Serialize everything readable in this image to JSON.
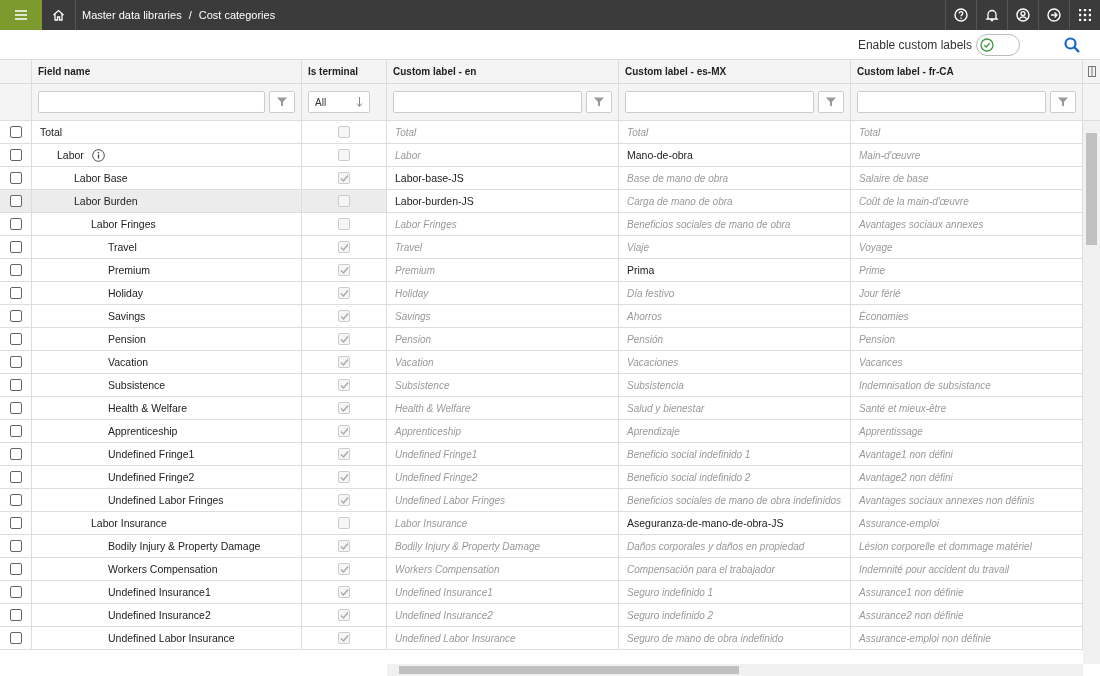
{
  "top_bar": {
    "breadcrumb": [
      {
        "label": "Master data libraries"
      },
      {
        "label": "Cost categories"
      }
    ],
    "separator": "/"
  },
  "toolbar": {
    "toggle_label": "Enable custom labels",
    "custom_labels_on": true
  },
  "table": {
    "columns": [
      {
        "label": "Field name",
        "kind": "text"
      },
      {
        "label": "Is terminal",
        "kind": "select",
        "value": "All"
      },
      {
        "label": "Custom label - en",
        "kind": "text"
      },
      {
        "label": "Custom label - es-MX",
        "kind": "text"
      },
      {
        "label": "Custom label - fr-CA",
        "kind": "text"
      }
    ],
    "rows": [
      {
        "name": "Total",
        "selected": false,
        "checked": false,
        "terminal": false,
        "labels": [
          {
            "text": "Total",
            "custom": false
          },
          {
            "text": "Total",
            "custom": false
          },
          {
            "text": "Total",
            "custom": false
          }
        ],
        "children": [
          {
            "name": "Labor",
            "info": true,
            "selected": false,
            "checked": false,
            "terminal": false,
            "labels": [
              {
                "text": "Labor",
                "custom": false
              },
              {
                "text": "Mano-de-obra",
                "custom": true
              },
              {
                "text": "Main-d'œuvre",
                "custom": false
              }
            ],
            "children": [
              {
                "name": "Labor Base",
                "selected": false,
                "checked": false,
                "terminal": true,
                "labels": [
                  {
                    "text": "Labor-base-JS",
                    "custom": true
                  },
                  {
                    "text": "Base de mano de obra",
                    "custom": false
                  },
                  {
                    "text": "Salaire de base",
                    "custom": false
                  }
                ]
              },
              {
                "name": "Labor Burden",
                "selected": true,
                "checked": false,
                "terminal": false,
                "labels": [
                  {
                    "text": "Labor-burden-JS",
                    "custom": true
                  },
                  {
                    "text": "Carga de mano de obra",
                    "custom": false
                  },
                  {
                    "text": "Coût de la main-d'œuvre",
                    "custom": false
                  }
                ],
                "children": [
                  {
                    "name": "Labor Fringes",
                    "selected": false,
                    "checked": false,
                    "terminal": false,
                    "labels": [
                      {
                        "text": "Labor Fringes",
                        "custom": false
                      },
                      {
                        "text": "Beneficios sociales de mano de obra",
                        "custom": false
                      },
                      {
                        "text": "Avantages sociaux annexes",
                        "custom": false
                      }
                    ],
                    "children": [
                      {
                        "name": "Travel",
                        "selected": false,
                        "checked": false,
                        "terminal": true,
                        "labels": [
                          {
                            "text": "Travel",
                            "custom": false
                          },
                          {
                            "text": "Viaje",
                            "custom": false
                          },
                          {
                            "text": "Voyage",
                            "custom": false
                          }
                        ]
                      },
                      {
                        "name": "Premium",
                        "selected": false,
                        "checked": false,
                        "terminal": true,
                        "labels": [
                          {
                            "text": "Premium",
                            "custom": false
                          },
                          {
                            "text": "Prima",
                            "custom": true
                          },
                          {
                            "text": "Prime",
                            "custom": false
                          }
                        ]
                      },
                      {
                        "name": "Holiday",
                        "selected": false,
                        "checked": false,
                        "terminal": true,
                        "labels": [
                          {
                            "text": "Holiday",
                            "custom": false
                          },
                          {
                            "text": "Día festivo",
                            "custom": false
                          },
                          {
                            "text": "Jour férié",
                            "custom": false
                          }
                        ]
                      },
                      {
                        "name": "Savings",
                        "selected": false,
                        "checked": false,
                        "terminal": true,
                        "labels": [
                          {
                            "text": "Savings",
                            "custom": false
                          },
                          {
                            "text": "Ahorros",
                            "custom": false
                          },
                          {
                            "text": "Économies",
                            "custom": false
                          }
                        ]
                      },
                      {
                        "name": "Pension",
                        "selected": false,
                        "checked": false,
                        "terminal": true,
                        "labels": [
                          {
                            "text": "Pension",
                            "custom": false
                          },
                          {
                            "text": "Pensión",
                            "custom": false
                          },
                          {
                            "text": "Pension",
                            "custom": false
                          }
                        ]
                      },
                      {
                        "name": "Vacation",
                        "selected": false,
                        "checked": false,
                        "terminal": true,
                        "labels": [
                          {
                            "text": "Vacation",
                            "custom": false
                          },
                          {
                            "text": "Vacaciones",
                            "custom": false
                          },
                          {
                            "text": "Vacances",
                            "custom": false
                          }
                        ]
                      },
                      {
                        "name": "Subsistence",
                        "selected": false,
                        "checked": false,
                        "terminal": true,
                        "labels": [
                          {
                            "text": "Subsistence",
                            "custom": false
                          },
                          {
                            "text": "Subsistencia",
                            "custom": false
                          },
                          {
                            "text": "Indemnisation de subsistance",
                            "custom": false
                          }
                        ]
                      },
                      {
                        "name": "Health & Welfare",
                        "selected": false,
                        "checked": false,
                        "terminal": true,
                        "labels": [
                          {
                            "text": "Health & Welfare",
                            "custom": false
                          },
                          {
                            "text": "Salud y bienestar",
                            "custom": false
                          },
                          {
                            "text": "Santé et mieux-être",
                            "custom": false
                          }
                        ]
                      },
                      {
                        "name": "Apprenticeship",
                        "selected": false,
                        "checked": false,
                        "terminal": true,
                        "labels": [
                          {
                            "text": "Apprenticeship",
                            "custom": false
                          },
                          {
                            "text": "Aprendizaje",
                            "custom": false
                          },
                          {
                            "text": "Apprentissage",
                            "custom": false
                          }
                        ]
                      },
                      {
                        "name": "Undefined Fringe1",
                        "selected": false,
                        "checked": false,
                        "terminal": true,
                        "labels": [
                          {
                            "text": "Undefined Fringe1",
                            "custom": false
                          },
                          {
                            "text": "Beneficio social indefinido 1",
                            "custom": false
                          },
                          {
                            "text": "Avantage1 non défini",
                            "custom": false
                          }
                        ]
                      },
                      {
                        "name": "Undefined Fringe2",
                        "selected": false,
                        "checked": false,
                        "terminal": true,
                        "labels": [
                          {
                            "text": "Undefined Fringe2",
                            "custom": false
                          },
                          {
                            "text": "Beneficio social indefinido 2",
                            "custom": false
                          },
                          {
                            "text": "Avantage2 non défini",
                            "custom": false
                          }
                        ]
                      },
                      {
                        "name": "Undefined Labor Fringes",
                        "selected": false,
                        "checked": false,
                        "terminal": true,
                        "labels": [
                          {
                            "text": "Undefined Labor Fringes",
                            "custom": false
                          },
                          {
                            "text": "Beneficios sociales de mano de obra indefinidos",
                            "custom": false
                          },
                          {
                            "text": "Avantages sociaux annexes non définis",
                            "custom": false
                          }
                        ]
                      }
                    ]
                  },
                  {
                    "name": "Labor Insurance",
                    "selected": false,
                    "checked": false,
                    "terminal": false,
                    "labels": [
                      {
                        "text": "Labor Insurance",
                        "custom": false
                      },
                      {
                        "text": "Aseguranza-de-mano-de-obra-JS",
                        "custom": true
                      },
                      {
                        "text": "Assurance-emploi",
                        "custom": false
                      }
                    ],
                    "children": [
                      {
                        "name": "Bodily Injury & Property Damage",
                        "selected": false,
                        "checked": false,
                        "terminal": true,
                        "labels": [
                          {
                            "text": "Bodily Injury & Property Damage",
                            "custom": false
                          },
                          {
                            "text": "Daños corporales y daños en propiedad",
                            "custom": false
                          },
                          {
                            "text": "Lésion corporelle et dommage matériel",
                            "custom": false
                          }
                        ]
                      },
                      {
                        "name": "Workers Compensation",
                        "selected": false,
                        "checked": false,
                        "terminal": true,
                        "labels": [
                          {
                            "text": "Workers Compensation",
                            "custom": false
                          },
                          {
                            "text": "Compensación para el trabajador",
                            "custom": false
                          },
                          {
                            "text": "Indemnité pour accident du travail",
                            "custom": false
                          }
                        ]
                      },
                      {
                        "name": "Undefined Insurance1",
                        "selected": false,
                        "checked": false,
                        "terminal": true,
                        "labels": [
                          {
                            "text": "Undefined Insurance1",
                            "custom": false
                          },
                          {
                            "text": "Seguro indefinido 1",
                            "custom": false
                          },
                          {
                            "text": "Assurance1 non définie",
                            "custom": false
                          }
                        ]
                      },
                      {
                        "name": "Undefined Insurance2",
                        "selected": false,
                        "checked": false,
                        "terminal": true,
                        "labels": [
                          {
                            "text": "Undefined Insurance2",
                            "custom": false
                          },
                          {
                            "text": "Seguro indefinido 2",
                            "custom": false
                          },
                          {
                            "text": "Assurance2 non définie",
                            "custom": false
                          }
                        ]
                      },
                      {
                        "name": "Undefined Labor Insurance",
                        "selected": false,
                        "checked": false,
                        "terminal": true,
                        "labels": [
                          {
                            "text": "Undefined Labor Insurance",
                            "custom": false
                          },
                          {
                            "text": "Seguro de mano de obra indefinido",
                            "custom": false
                          },
                          {
                            "text": "Assurance-emploi non définie",
                            "custom": false
                          }
                        ]
                      }
                    ]
                  }
                ]
              }
            ]
          }
        ]
      }
    ]
  }
}
